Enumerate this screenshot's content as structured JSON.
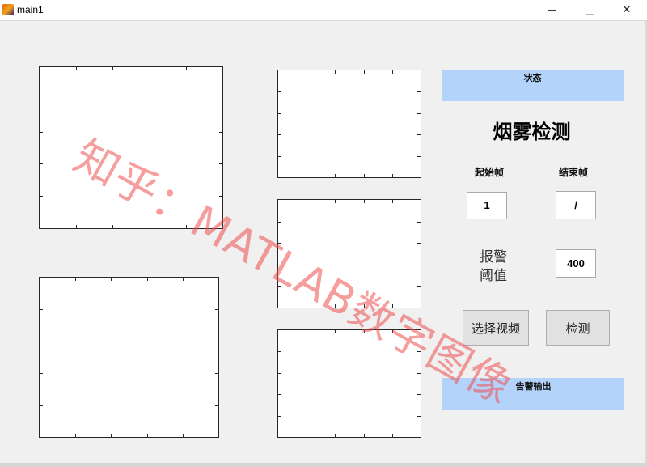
{
  "window": {
    "title": "main1",
    "icon": "matlab-logo-icon",
    "minimize_glyph": "",
    "maximize_glyph": "",
    "close_glyph": "✕"
  },
  "panels": {
    "status_title": "状态",
    "alarm_output_title": "告警输出"
  },
  "main_title": "烟雾检测",
  "frames": {
    "start_label": "起始帧",
    "end_label": "结束帧",
    "start_value": "1",
    "end_value": "/"
  },
  "threshold": {
    "label_line1": "报警",
    "label_line2": "阈值",
    "value": "400"
  },
  "buttons": {
    "select_video": "选择视频",
    "detect": "检测"
  },
  "watermark": "知乎：MATLAB数字图像",
  "colors": {
    "panel_blue": "#b4d3fb",
    "watermark_red": "#ee4e4e"
  }
}
